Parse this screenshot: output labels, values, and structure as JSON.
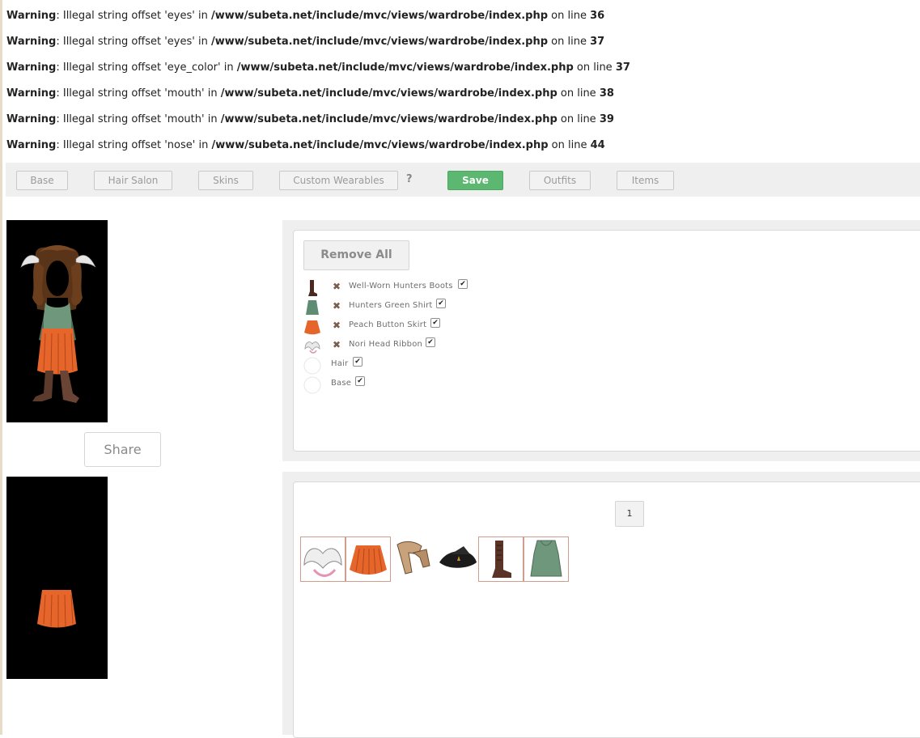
{
  "warnings": [
    {
      "label": "Warning",
      "pre": ": Illegal string offset 'eyes' in ",
      "path": "/www/subeta.net/include/mvc/views/wardrobe/index.php",
      "mid": " on line ",
      "line": "36"
    },
    {
      "label": "Warning",
      "pre": ": Illegal string offset 'eyes' in ",
      "path": "/www/subeta.net/include/mvc/views/wardrobe/index.php",
      "mid": " on line ",
      "line": "37"
    },
    {
      "label": "Warning",
      "pre": ": Illegal string offset 'eye_color' in ",
      "path": "/www/subeta.net/include/mvc/views/wardrobe/index.php",
      "mid": " on line ",
      "line": "37"
    },
    {
      "label": "Warning",
      "pre": ": Illegal string offset 'mouth' in ",
      "path": "/www/subeta.net/include/mvc/views/wardrobe/index.php",
      "mid": " on line ",
      "line": "38"
    },
    {
      "label": "Warning",
      "pre": ": Illegal string offset 'mouth' in ",
      "path": "/www/subeta.net/include/mvc/views/wardrobe/index.php",
      "mid": " on line ",
      "line": "39"
    },
    {
      "label": "Warning",
      "pre": ": Illegal string offset 'nose' in ",
      "path": "/www/subeta.net/include/mvc/views/wardrobe/index.php",
      "mid": " on line ",
      "line": "44"
    }
  ],
  "toolbar": {
    "base": "Base",
    "hair_salon": "Hair Salon",
    "skins": "Skins",
    "custom_wearables": "Custom Wearables",
    "help": "?",
    "save": "Save",
    "outfits": "Outfits",
    "items": "Items"
  },
  "share_label": "Share",
  "worn_panel": {
    "remove_all": "Remove All",
    "items": [
      {
        "name": "Well-Worn Hunters Boots",
        "icon": "boot-icon",
        "removable": true,
        "checked": true
      },
      {
        "name": "Hunters Green Shirt",
        "icon": "shirt-icon",
        "removable": true,
        "checked": true
      },
      {
        "name": "Peach Button Skirt",
        "icon": "skirt-icon",
        "removable": true,
        "checked": true
      },
      {
        "name": "Nori Head Ribbon",
        "icon": "ribbon-wings-icon",
        "removable": true,
        "checked": true
      },
      {
        "name": "Hair",
        "icon": "blank-circle-icon",
        "removable": false,
        "checked": true
      },
      {
        "name": "Base",
        "icon": "blank-circle-icon",
        "removable": false,
        "checked": true
      }
    ],
    "remove_glyph": "✖",
    "check_glyph": "✔"
  },
  "inventory_panel": {
    "page": "1",
    "items": [
      {
        "icon": "ribbon-wings-icon",
        "selected": true
      },
      {
        "icon": "skirt-icon",
        "selected": true
      },
      {
        "icon": "gloves-icon",
        "selected": false
      },
      {
        "icon": "hat-icon",
        "selected": false
      },
      {
        "icon": "boot-icon",
        "selected": true
      },
      {
        "icon": "shirt-icon",
        "selected": true
      }
    ]
  },
  "colors": {
    "save_green": "#5cb870",
    "toolbar_bg": "#efefef",
    "preview_bg": "#000000",
    "remove_x": "#7a5c4c",
    "selected_border": "#d09c8e"
  }
}
